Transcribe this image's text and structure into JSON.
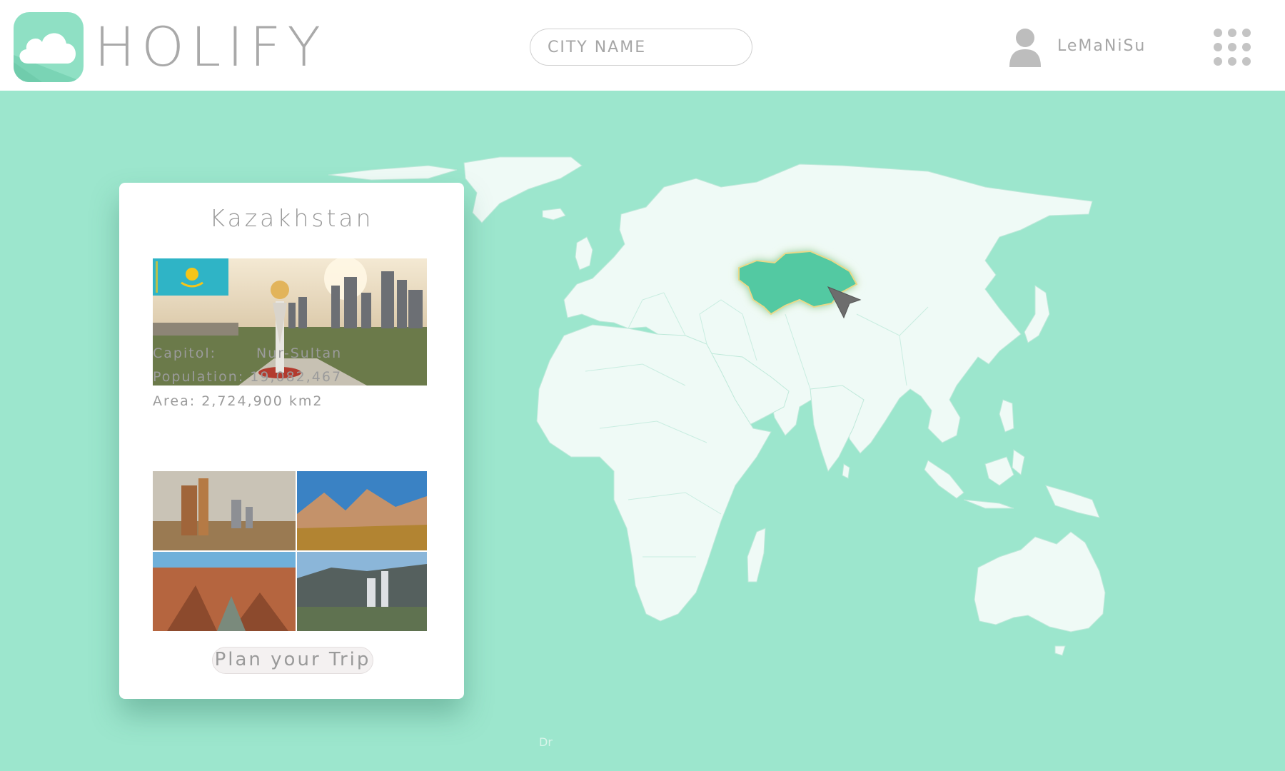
{
  "app": {
    "name": "HOLIFY",
    "logo_icon": "cloud-icon"
  },
  "header": {
    "search_placeholder": "CITY NAME",
    "user_icon": "user-icon",
    "username": "LeMaNiSu",
    "apps_icon": "grid-dots-icon"
  },
  "map": {
    "selected_country": "Kazakhstan",
    "highlight_color": "#52c9a2",
    "land_color": "#effaf6",
    "water_color": "#9ce6cd",
    "credit_text": "Dr",
    "cursor_icon": "arrow-cursor-icon"
  },
  "card": {
    "title": "Kazakhstan",
    "flag_icon": "kazakhstan-flag-icon",
    "capitol_label": "Capitol:",
    "capitol_value": "Nur-Sultan",
    "population_label": "Population:",
    "population_value": "19,082,467",
    "area_label": "Area:",
    "area_value": "2,724,900 km2",
    "plan_button": "Plan your Trip"
  }
}
